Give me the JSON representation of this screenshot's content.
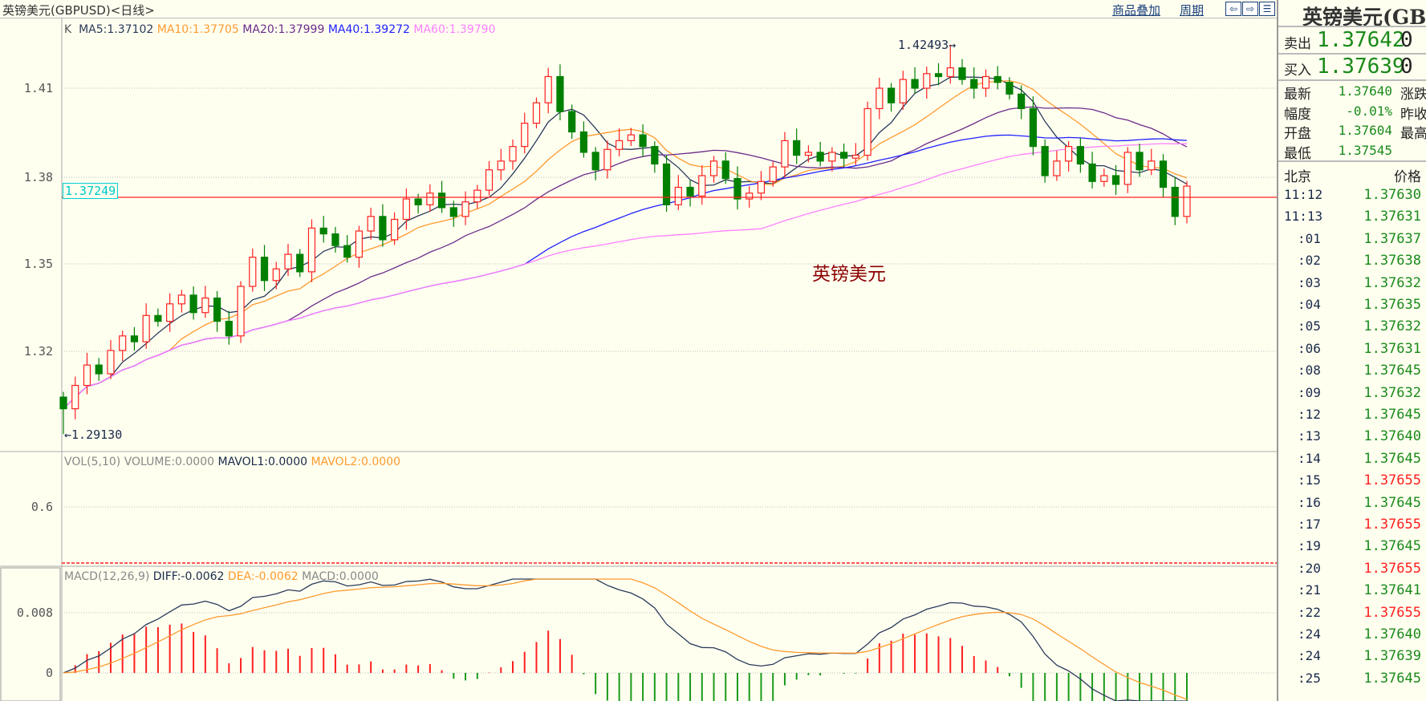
{
  "header": {
    "title": "英镑美元(GBPUSD)<日线>",
    "overlay_link": "商品叠加",
    "period_link": "周期",
    "icons": [
      "arrow-left-icon",
      "arrow-right-icon",
      "layout-icon"
    ]
  },
  "main_panel": {
    "k_label": "K",
    "ma5": "MA5:1.37102",
    "ma10": "MA10:1.37705",
    "ma20": "MA20:1.37999",
    "ma40": "MA40:1.39272",
    "ma60": "MA60:1.39790",
    "current_price_tag": "1.37249",
    "high_label": "1.42493→",
    "low_label": "←1.29130",
    "watermark": "英镑美元",
    "colors": {
      "up": "#ff2020",
      "down": "#008000",
      "ma5": "#2a3a5a",
      "ma10": "#ff9a2e",
      "ma20": "#6a2c8a",
      "ma40": "#2020ff",
      "ma60": "#ff80ff"
    }
  },
  "vol_panel": {
    "label": "VOL(5,10) VOLUME:0.0000",
    "mavol1": "MAVOL1:0.0000",
    "mavol2": "MAVOL2:0.0000",
    "tick": "0.6"
  },
  "macd_panel": {
    "label": "MACD(12,26,9)",
    "diff": "DIFF:-0.0062",
    "dea": "DEA:-0.0062",
    "macd": "MACD:0.0000",
    "ticks": [
      "0.008",
      "0"
    ]
  },
  "chart_data": {
    "type": "candlestick",
    "title": "英镑美元(GBPUSD)<日线>",
    "y_ticks": [
      "1.41",
      "1.38",
      "1.35",
      "1.32"
    ],
    "ylim": [
      1.2913,
      1.42493
    ],
    "close": [
      1.3,
      1.308,
      1.315,
      1.312,
      1.32,
      1.325,
      1.323,
      1.332,
      1.33,
      1.336,
      1.339,
      1.333,
      1.338,
      1.33,
      1.325,
      1.342,
      1.352,
      1.344,
      1.348,
      1.353,
      1.347,
      1.362,
      1.36,
      1.356,
      1.352,
      1.361,
      1.366,
      1.358,
      1.365,
      1.372,
      1.37,
      1.374,
      1.369,
      1.366,
      1.371,
      1.375,
      1.382,
      1.385,
      1.39,
      1.398,
      1.405,
      1.414,
      1.402,
      1.395,
      1.388,
      1.382,
      1.389,
      1.392,
      1.394,
      1.39,
      1.384,
      1.37,
      1.376,
      1.373,
      1.38,
      1.385,
      1.379,
      1.372,
      1.374,
      1.378,
      1.383,
      1.392,
      1.387,
      1.388,
      1.385,
      1.388,
      1.386,
      1.387,
      1.403,
      1.41,
      1.405,
      1.413,
      1.41,
      1.415,
      1.414,
      1.417,
      1.413,
      1.41,
      1.414,
      1.412,
      1.408,
      1.403,
      1.39,
      1.38,
      1.385,
      1.39,
      1.384,
      1.378,
      1.38,
      1.377,
      1.388,
      1.382,
      1.385,
      1.376,
      1.366,
      1.3764
    ],
    "first_open": 1.304,
    "high": 1.42493,
    "low": 1.2913,
    "reference_line": 1.37249
  },
  "quote": {
    "title": "英镑美元(GBPUSD)",
    "sell_label": "卖出",
    "sell_value": "1.37642",
    "sell_vol": "0",
    "buy_label": "买入",
    "buy_value": "1.37639",
    "buy_vol": "0",
    "stats": [
      {
        "label": "最新",
        "value": "1.37640",
        "label2": "涨跌"
      },
      {
        "label": "幅度",
        "value": "-0.01%",
        "label2": "昨收"
      },
      {
        "label": "开盘",
        "value": "1.37604",
        "label2": "最高"
      },
      {
        "label": "最低",
        "value": "1.37545",
        "label2": ""
      }
    ],
    "ticks_header": {
      "time": "北京",
      "price": "价格"
    },
    "ticks": [
      {
        "time": "11:12",
        "price": "1.37630",
        "dir": "down"
      },
      {
        "time": "11:13",
        "price": "1.37631",
        "dir": "down"
      },
      {
        "time": ":01",
        "price": "1.37637",
        "dir": "down"
      },
      {
        "time": ":02",
        "price": "1.37638",
        "dir": "down"
      },
      {
        "time": ":03",
        "price": "1.37632",
        "dir": "down"
      },
      {
        "time": ":04",
        "price": "1.37635",
        "dir": "down"
      },
      {
        "time": ":05",
        "price": "1.37632",
        "dir": "down"
      },
      {
        "time": ":06",
        "price": "1.37631",
        "dir": "down"
      },
      {
        "time": ":08",
        "price": "1.37645",
        "dir": "down"
      },
      {
        "time": ":09",
        "price": "1.37632",
        "dir": "down"
      },
      {
        "time": ":12",
        "price": "1.37645",
        "dir": "down"
      },
      {
        "time": ":13",
        "price": "1.37640",
        "dir": "down"
      },
      {
        "time": ":14",
        "price": "1.37645",
        "dir": "down"
      },
      {
        "time": ":15",
        "price": "1.37655",
        "dir": "up"
      },
      {
        "time": ":16",
        "price": "1.37645",
        "dir": "down"
      },
      {
        "time": ":17",
        "price": "1.37655",
        "dir": "up"
      },
      {
        "time": ":19",
        "price": "1.37645",
        "dir": "down"
      },
      {
        "time": ":20",
        "price": "1.37655",
        "dir": "up"
      },
      {
        "time": ":21",
        "price": "1.37641",
        "dir": "down"
      },
      {
        "time": ":22",
        "price": "1.37655",
        "dir": "up"
      },
      {
        "time": ":24",
        "price": "1.37640",
        "dir": "down"
      },
      {
        "time": ":24",
        "price": "1.37639",
        "dir": "down"
      },
      {
        "time": ":25",
        "price": "1.37645",
        "dir": "down"
      }
    ]
  }
}
